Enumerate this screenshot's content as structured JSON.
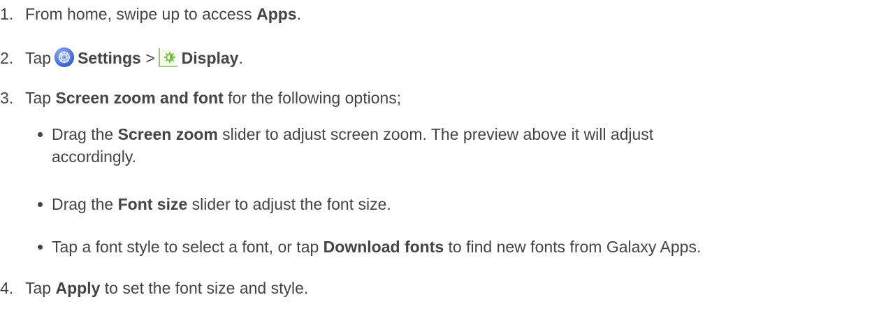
{
  "steps": [
    {
      "num": "1.",
      "parts": [
        "From home, swipe up to access ",
        "Apps",
        "."
      ]
    },
    {
      "num": "2.",
      "pre": "Tap",
      "settings": "Settings",
      "sep": ">",
      "display": "Display",
      "end": "."
    },
    {
      "num": "3.",
      "parts": [
        "Tap ",
        "Screen zoom and font",
        " for the following options;"
      ]
    },
    {
      "num": "4.",
      "parts": [
        "Tap ",
        "Apply",
        " to set the font size and style."
      ]
    }
  ],
  "bullets": [
    {
      "pre": "Drag the ",
      "bold": "Screen zoom",
      "post": " slider to adjust screen zoom. The preview above it will adjust",
      "cont": "accordingly."
    },
    {
      "pre": "Drag the ",
      "bold": "Font size",
      "post": " slider to adjust the font size."
    },
    {
      "pre": "Tap a font style to select a font, or tap ",
      "bold": "Download fonts",
      "post": " to find new fonts from Galaxy Apps."
    }
  ],
  "icons": {
    "settings": "settings-gear-icon",
    "display": "display-brightness-icon",
    "settings_color": "#4e73e8",
    "display_color": "#7cc242"
  }
}
